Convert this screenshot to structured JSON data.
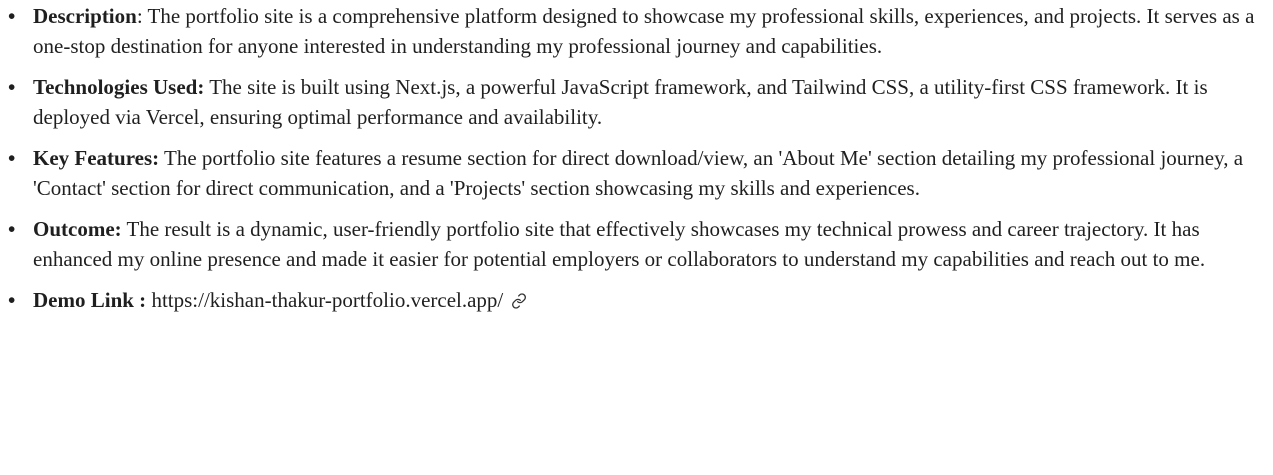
{
  "items": [
    {
      "label": "Description",
      "text": ": The portfolio site is a comprehensive platform designed to showcase my professional skills, experiences, and projects. It serves as a one-stop destination for anyone interested in understanding my professional journey and capabilities."
    },
    {
      "label": "Technologies Used:",
      "text": " The site is built using Next.js, a powerful JavaScript framework, and Tailwind CSS, a utility-first CSS framework. It is deployed via Vercel, ensuring optimal performance and availability."
    },
    {
      "label": "Key Features:",
      "text": " The portfolio site features a resume section for direct download/view, an 'About Me' section detailing my professional journey, a 'Contact' section for direct communication, and a 'Projects' section showcasing my skills and experiences."
    },
    {
      "label": "Outcome:",
      "text": " The result is a dynamic, user-friendly portfolio site that effectively showcases my technical prowess and career trajectory. It has enhanced my online presence and made it easier for potential employers or collaborators to understand my capabilities and reach out to me."
    },
    {
      "label": "Demo Link :",
      "link_text": "https://kishan-thakur-portfolio.vercel.app/",
      "link_icon": "link-icon"
    }
  ],
  "bullet_char": "•"
}
